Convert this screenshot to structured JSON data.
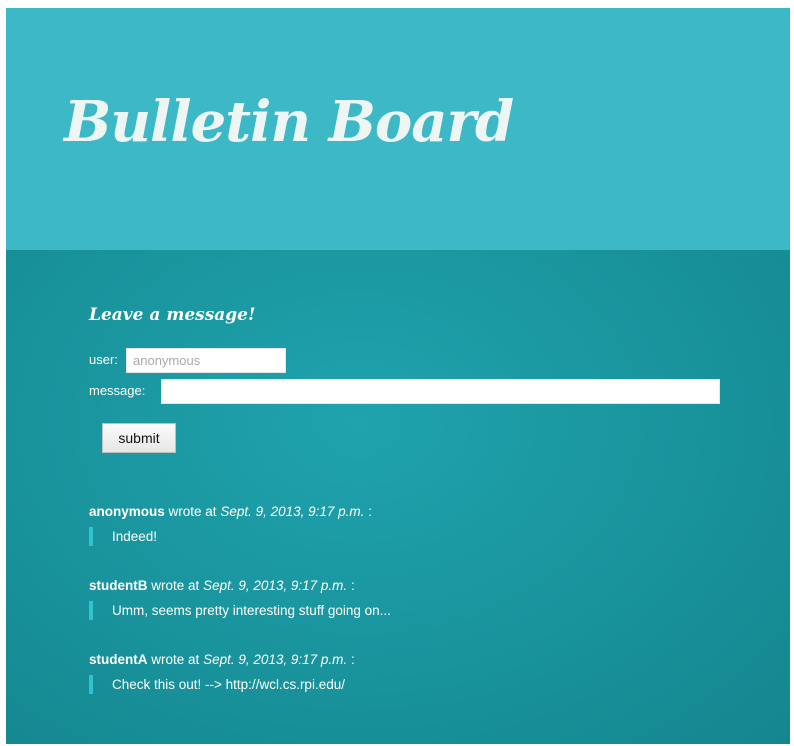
{
  "header": {
    "title": "Bulletin Board"
  },
  "form": {
    "heading": "Leave a message!",
    "user_label": "user:",
    "user_placeholder": "anonymous",
    "message_label": "message:",
    "message_value": "",
    "submit_label": "submit"
  },
  "messages": [
    {
      "author": "anonymous",
      "wrote_at": "wrote at",
      "timestamp": "Sept. 9, 2013, 9:17 p.m.",
      "suffix": ":",
      "body": "Indeed!"
    },
    {
      "author": "studentB",
      "wrote_at": "wrote at",
      "timestamp": "Sept. 9, 2013, 9:17 p.m.",
      "suffix": ":",
      "body": "Umm, seems pretty interesting stuff going on..."
    },
    {
      "author": "studentA",
      "wrote_at": "wrote at",
      "timestamp": "Sept. 9, 2013, 9:17 p.m.",
      "suffix": ":",
      "body": "Check this out! --> http://wcl.cs.rpi.edu/"
    }
  ],
  "colors": {
    "header_bg": "#3db8c6",
    "main_bg": "#19939c",
    "quote_bar": "#2fc3cf",
    "text": "#ffffff"
  }
}
